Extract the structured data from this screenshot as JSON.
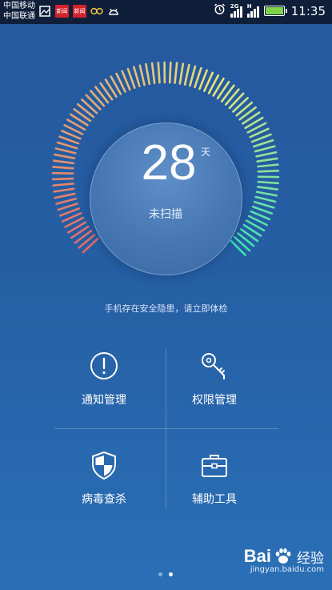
{
  "status_bar": {
    "carrier_1": "中国移动",
    "carrier_2": "中国联通",
    "notification_badge_1": "新闻",
    "notification_badge_2": "新闻",
    "network_2g": "2G",
    "network_h": "H",
    "battery_level": 1.0,
    "battery_color": "#7fd34b",
    "time": "11:35"
  },
  "security": {
    "days": "28",
    "days_unit": "天",
    "scan_status": "未扫描",
    "warning": "手机存在安全隐患，请立即体检"
  },
  "tiles": [
    {
      "label": "通知管理",
      "icon": "exclamation-circle-icon"
    },
    {
      "label": "权限管理",
      "icon": "key-icon"
    },
    {
      "label": "病毒查杀",
      "icon": "shield-icon"
    },
    {
      "label": "辅助工具",
      "icon": "toolbox-icon"
    }
  ],
  "pager": {
    "count": 2,
    "active": 1
  },
  "watermark": {
    "logo": "Bai",
    "logo_suffix": "经验",
    "url": "jingyan.baidu.com"
  },
  "colors": {
    "accent_red": "#e06a6a",
    "accent_yellow": "#e6e27a",
    "accent_teal": "#3de0b8",
    "background": "#255ea3"
  }
}
